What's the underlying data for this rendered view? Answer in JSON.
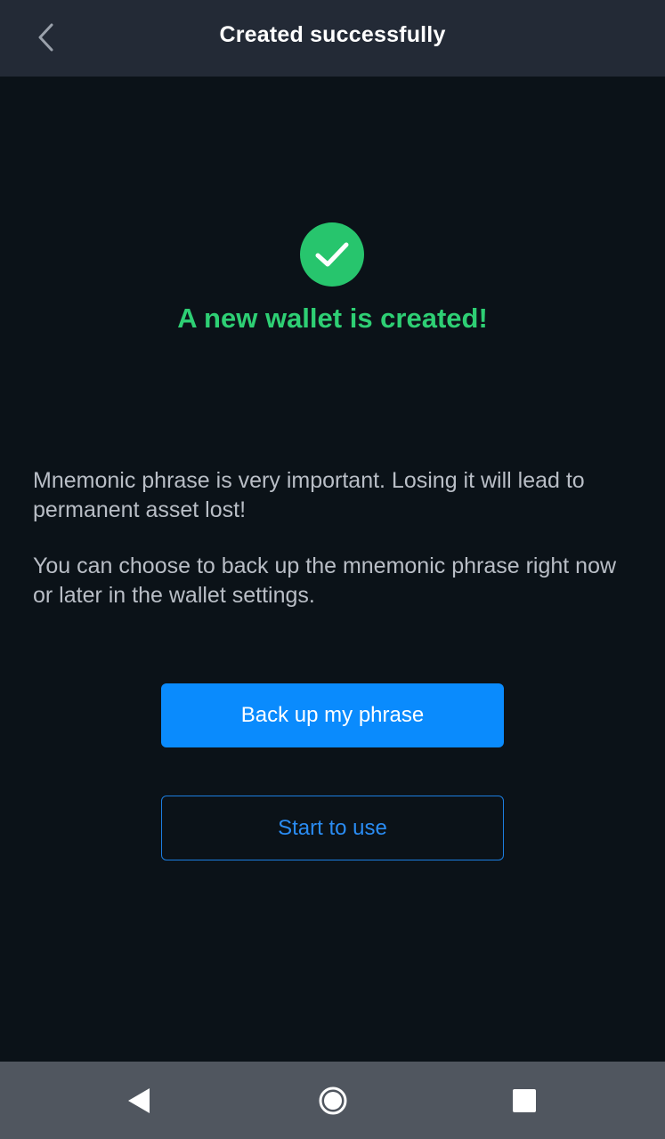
{
  "header": {
    "title": "Created successfully",
    "back_icon": "chevron-left-icon"
  },
  "success": {
    "icon": "check-circle-icon",
    "heading": "A new wallet is created!",
    "color": "#2ecf74"
  },
  "messages": {
    "warning": "Mnemonic phrase is very important. Losing it will lead to permanent asset lost!",
    "backup_info": "You can choose to back up the mnemonic phrase right now or later in the wallet settings."
  },
  "actions": {
    "backup_label": "Back up my phrase",
    "start_label": "Start to use",
    "accent_color": "#0a8bfd"
  },
  "system_nav": {
    "back_icon": "triangle-back-icon",
    "home_icon": "circle-home-icon",
    "recents_icon": "square-recents-icon"
  }
}
